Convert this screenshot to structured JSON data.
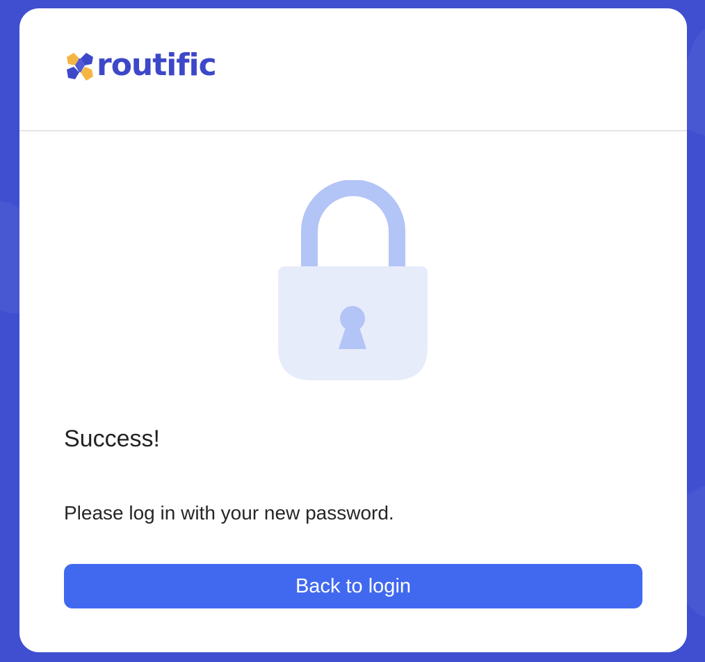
{
  "brand": {
    "name": "routific",
    "logo_color": "#3d48c8",
    "logo_accent": "#f5b544"
  },
  "illustration": {
    "icon": "padlock-icon",
    "shackle_color": "#b3c4f6",
    "body_color": "#e7ecfa",
    "keyhole_color": "#b3c4f6"
  },
  "content": {
    "title": "Success!",
    "message": "Please log in with your new password.",
    "button_label": "Back to login"
  },
  "colors": {
    "background": "#3f4fd0",
    "primary": "#4169ef"
  }
}
